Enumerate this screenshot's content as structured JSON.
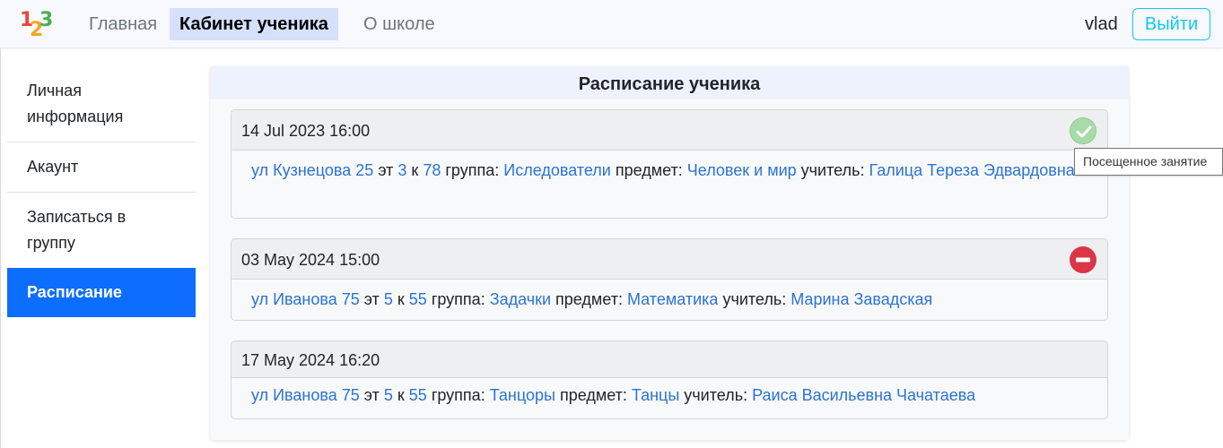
{
  "navbar": {
    "logo": {
      "d1": "1",
      "d2": "2",
      "d3": "3"
    },
    "links": {
      "home": "Главная",
      "cabinet": "Кабинет ученика",
      "school": "О школе"
    },
    "user": "vlad",
    "logout": "Выйти"
  },
  "sidebar": {
    "items": [
      {
        "label": "Личная информация"
      },
      {
        "label": "Акаунт"
      },
      {
        "label": "Записаться в группу"
      },
      {
        "label": "Расписание"
      }
    ]
  },
  "main": {
    "title": "Расписание ученика",
    "labels": {
      "floor": "эт",
      "room": "к",
      "group": "группа:",
      "subject": "предмет:",
      "teacher": "учитель:"
    },
    "lessons": [
      {
        "datetime": "14 Jul 2023 16:00",
        "address": "ул Кузнецова 25",
        "floor": "3",
        "room": "78",
        "group": "Иследователи",
        "subject": "Человек и мир",
        "teacher": "Галица Тереза Эдвардовна",
        "status": "attended",
        "status_icon": "check-circle-icon",
        "status_color": "#a8dba7"
      },
      {
        "datetime": "03 May 2024 15:00",
        "address": "ул Иванова 75",
        "floor": "5",
        "room": "55",
        "group": "Задачки",
        "subject": "Математика",
        "teacher": "Марина Завадская",
        "status": "missed",
        "status_icon": "no-entry-icon",
        "status_color": "#dc3545"
      },
      {
        "datetime": "17 May 2024 16:20",
        "address": "ул Иванова 75",
        "floor": "5",
        "room": "55",
        "group": "Танцоры",
        "subject": "Танцы",
        "teacher": "Раиса Васильевна Чачатаева"
      }
    ]
  },
  "tooltip": "Посещенное занятие",
  "colors": {
    "accent": "#0d6efd",
    "link": "#2c73d2",
    "logout": "#0dcaf0"
  }
}
